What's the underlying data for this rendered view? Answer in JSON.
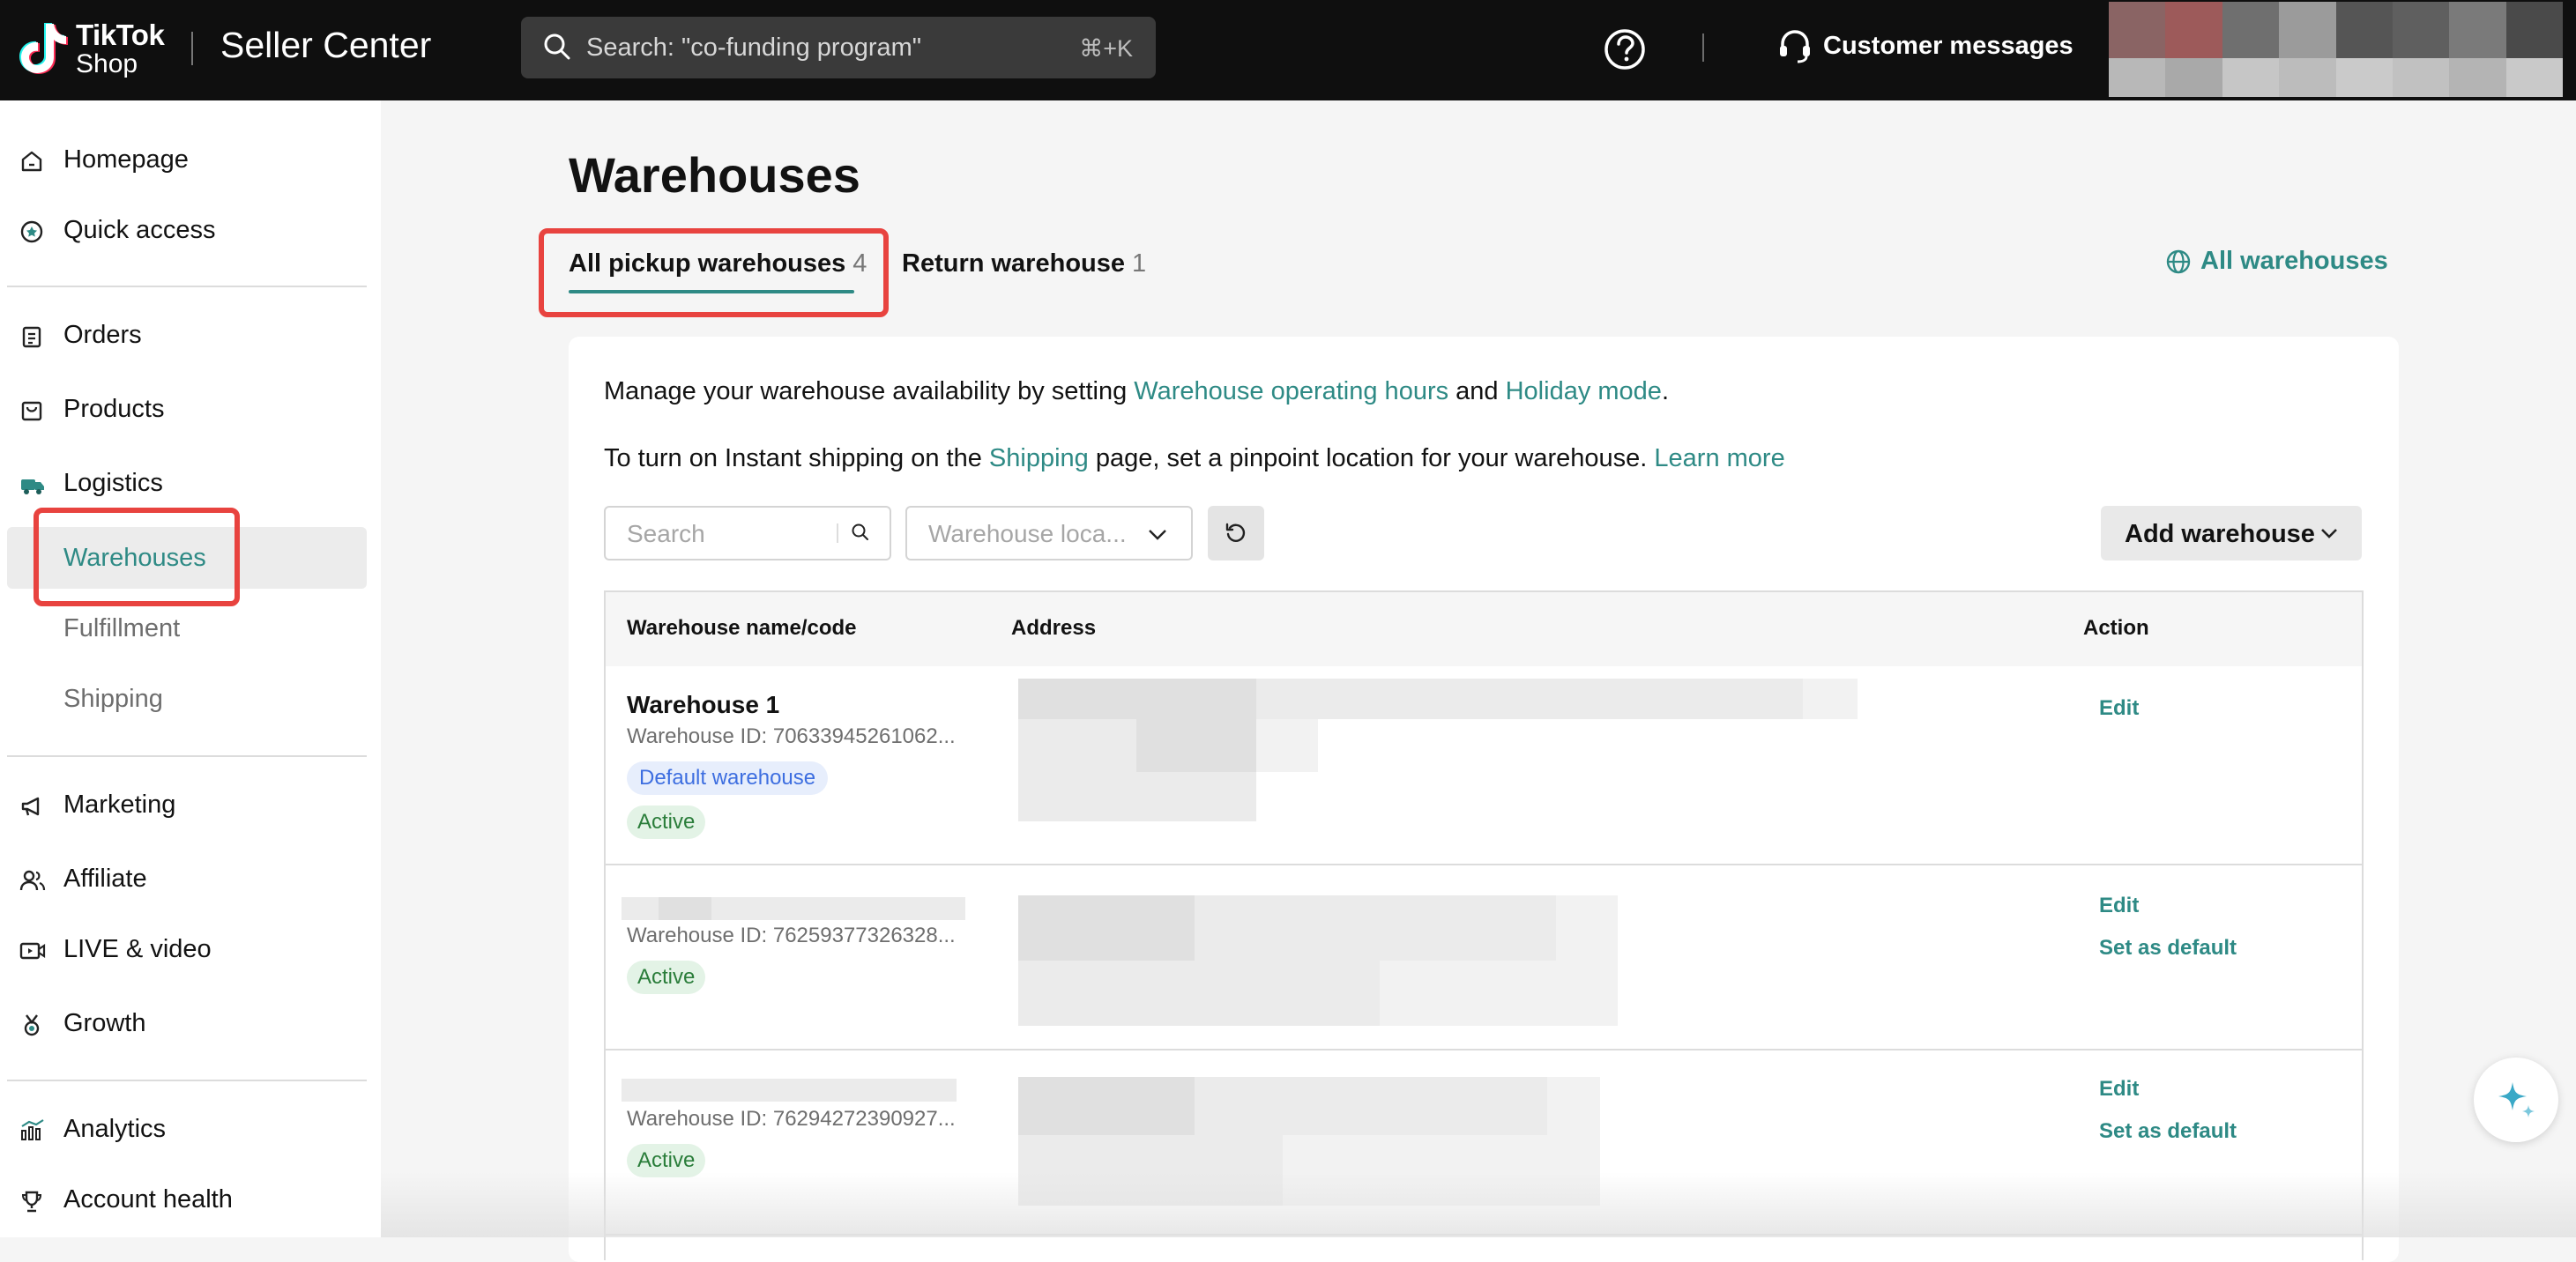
{
  "topbar": {
    "logo_line1": "TikTok",
    "logo_line2": "Shop",
    "brand": "Seller Center",
    "search_placeholder": "Search: \"co-funding program\"",
    "search_shortcut": "⌘+K",
    "help_icon": "question-circle-icon",
    "customer_messages": "Customer messages"
  },
  "sidebar": {
    "items": [
      {
        "label": "Homepage",
        "icon": "home-icon"
      },
      {
        "label": "Quick access",
        "icon": "star-circle-icon"
      },
      {
        "label": "Orders",
        "icon": "clipboard-icon"
      },
      {
        "label": "Products",
        "icon": "shopping-bag-icon"
      },
      {
        "label": "Logistics",
        "icon": "truck-icon"
      },
      {
        "label": "Marketing",
        "icon": "megaphone-icon"
      },
      {
        "label": "Affiliate",
        "icon": "people-icon"
      },
      {
        "label": "LIVE & video",
        "icon": "video-icon"
      },
      {
        "label": "Growth",
        "icon": "medal-icon"
      },
      {
        "label": "Analytics",
        "icon": "bar-chart-icon"
      },
      {
        "label": "Account health",
        "icon": "trophy-icon"
      }
    ],
    "logistics_sub": [
      "Warehouses",
      "Fulfillment",
      "Shipping"
    ]
  },
  "main": {
    "title": "Warehouses",
    "tabs": [
      {
        "label": "All pickup warehouses",
        "count": "4"
      },
      {
        "label": "Return warehouse",
        "count": "1"
      }
    ],
    "all_warehouses_link": "All warehouses",
    "info1": {
      "pre": "Manage your warehouse availability by setting ",
      "link1": "Warehouse operating hours",
      "mid": " and ",
      "link2": "Holiday mode",
      "post": "."
    },
    "info2": {
      "pre": "To turn on Instant shipping on the ",
      "link1": "Shipping",
      "mid": " page, set a pinpoint location for your warehouse. ",
      "link2": "Learn more"
    },
    "search_placeholder": "Search",
    "location_placeholder": "Warehouse loca...",
    "add_warehouse": "Add warehouse"
  },
  "table": {
    "headers": [
      "Warehouse name/code",
      "Address",
      "Action"
    ],
    "rows": [
      {
        "name": "Warehouse 1",
        "id": "Warehouse ID: 70633945261062...",
        "default_tag": "Default warehouse",
        "status": "Active",
        "actions": [
          "Edit"
        ]
      },
      {
        "name": "",
        "id": "Warehouse ID: 76259377326328...",
        "status": "Active",
        "actions": [
          "Edit",
          "Set as default"
        ]
      },
      {
        "name": "",
        "id": "Warehouse ID: 76294272390927...",
        "status": "Active",
        "actions": [
          "Edit",
          "Set as default"
        ]
      }
    ]
  },
  "colors": {
    "accent": "#2e8a85",
    "highlight": "#e8433f",
    "topbar": "#0f0f0f"
  }
}
